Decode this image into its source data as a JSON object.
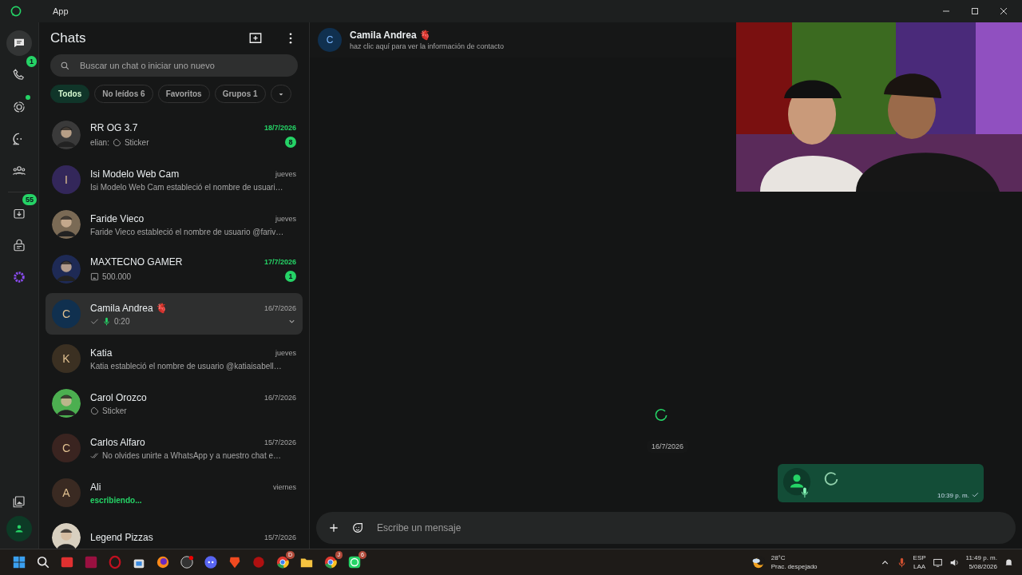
{
  "window": {
    "title": "App"
  },
  "rail": {
    "top": [
      {
        "kind": "chats",
        "selected": true
      },
      {
        "kind": "calls",
        "selected": false,
        "badge": "1"
      },
      {
        "kind": "status",
        "selected": false,
        "dot": true
      },
      {
        "kind": "channels",
        "selected": false
      },
      {
        "kind": "communities",
        "selected": false
      }
    ],
    "middle": [
      {
        "kind": "archive",
        "badge": "55"
      },
      {
        "kind": "locked"
      },
      {
        "kind": "meta"
      }
    ],
    "bottom": [
      {
        "kind": "media"
      },
      {
        "kind": "profile"
      }
    ]
  },
  "sidebar": {
    "title": "Chats",
    "search": {
      "placeholder": "Buscar un chat o iniciar uno nuevo"
    },
    "filters": [
      {
        "label": "Todos",
        "selected": true
      },
      {
        "label": "No leídos",
        "count": "6",
        "selected": false
      },
      {
        "label": "Favoritos",
        "selected": false
      },
      {
        "label": "Grupos",
        "count": "1",
        "selected": false
      }
    ],
    "chats": [
      {
        "kind": "sticker",
        "name": "RR OG 3.7",
        "time": "18/7/2026",
        "unread": "8",
        "sender": "elian:",
        "preview": "Sticker",
        "selected": false
      },
      {
        "kind": "text",
        "name": "Isi Modelo Web Cam",
        "time": "jueves",
        "preview": "Isi Modelo Web Cam estableció el nombre de usuari…",
        "initial": "I",
        "color": "#33275a",
        "selected": false
      },
      {
        "kind": "text",
        "name": "Faride Vieco",
        "time": "jueves",
        "preview": "Faride Vieco estableció el nombre de usuario @fariv…",
        "selected": false
      },
      {
        "name": "MAXTECNO GAMER",
        "time": "17/7/2026",
        "unread": "1",
        "preview": "500.000",
        "selected": false
      },
      {
        "kind": "voice",
        "name": "Camila Andrea",
        "emoji": "🫀",
        "time": "16/7/2026",
        "preview": "0:20",
        "initial": "C",
        "color": "#10304f",
        "selected": true
      },
      {
        "kind": "text",
        "name": "Katia",
        "time": "jueves",
        "preview": "Katia estableció el nombre de usuario @katiaisabell…",
        "initial": "K",
        "color": "#3b3022",
        "selected": false
      },
      {
        "kind": "sticker",
        "name": "Carol Orozco",
        "time": "16/7/2026",
        "preview": "Sticker",
        "selected": false
      },
      {
        "kind": "read",
        "name": "Carlos Alfaro",
        "time": "15/7/2026",
        "preview": "No olvides unirte a WhatsApp y a nuestro chat e…",
        "initial": "C",
        "color": "#3a2420",
        "selected": false
      },
      {
        "kind": "typing",
        "name": "Ali",
        "time": "viernes",
        "preview": "escribiendo...",
        "initial": "A",
        "color": "#3a2a22",
        "selected": false
      },
      {
        "name": "Legend Pizzas",
        "time": "15/7/2026",
        "selected": false
      }
    ]
  },
  "conversation": {
    "initial": "C",
    "name": "Camila Andrea",
    "emoji": "🫀",
    "subtitle": "haz clic aquí para ver la información de contacto",
    "date": "16/7/2026",
    "messages": [
      {
        "kind": "voice",
        "time": "10:39 p. m."
      }
    ],
    "composer": {
      "placeholder": "Escribe un mensaje"
    }
  },
  "taskbar": {
    "apps": [
      {
        "kind": "start"
      },
      {
        "kind": "search"
      },
      {
        "kind": "red"
      },
      {
        "kind": "adobe"
      },
      {
        "kind": "opera"
      },
      {
        "kind": "store"
      },
      {
        "kind": "firefox"
      },
      {
        "kind": "obs"
      },
      {
        "kind": "discord"
      },
      {
        "kind": "brave"
      },
      {
        "kind": "redcircle"
      },
      {
        "kind": "chrome",
        "badge": "D"
      },
      {
        "kind": "folder"
      },
      {
        "kind": "chrome",
        "badge": "J"
      },
      {
        "kind": "whatsapp",
        "badge": "6"
      }
    ],
    "weather": {
      "temp": "28°C",
      "desc": "Prac. despejado"
    },
    "lang": [
      "ESP",
      "LAA"
    ],
    "clock": [
      "11:49 p. m.",
      "5/08/2026"
    ]
  }
}
